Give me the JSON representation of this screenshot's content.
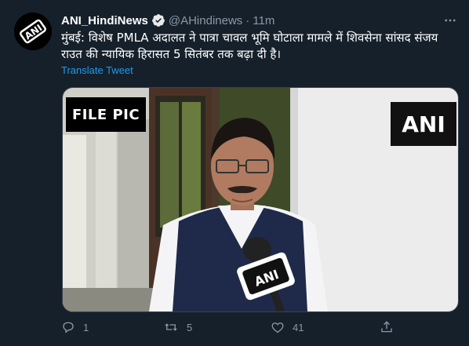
{
  "tweet": {
    "display_name": "ANI_HindiNews",
    "handle": "@AHindinews",
    "separator": "·",
    "time": "11m",
    "text": "मुंबई: विशेष PMLA अदालत ने पात्रा चावल भूमि घोटाला मामले में शिवसेना सांसद संजय राउत की न्यायिक हिरासत 5 सितंबर तक बढ़ा दी है।",
    "translate_label": "Translate Tweet",
    "media": {
      "overlay_left": "FILE PIC",
      "overlay_right": "ANI",
      "mic_label": "ANI"
    },
    "avatar_text": "ANI",
    "actions": {
      "reply_count": "1",
      "retweet_count": "5",
      "like_count": "41",
      "share_count": ""
    }
  },
  "colors": {
    "background": "#15202b",
    "text_primary": "#ffffff",
    "text_secondary": "#8b98a5",
    "link": "#1d9bf0",
    "verified": "#1d9bf0",
    "border": "#38444d"
  },
  "icons": {
    "verified": "verified-badge-icon",
    "more": "more-options-icon",
    "reply": "reply-icon",
    "retweet": "retweet-icon",
    "like": "heart-icon",
    "share": "share-icon"
  }
}
